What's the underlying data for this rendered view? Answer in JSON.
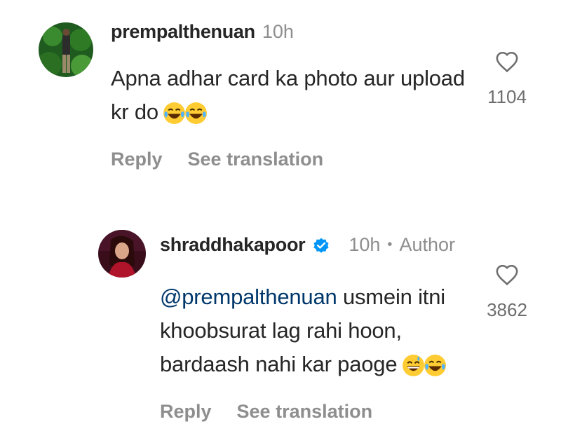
{
  "comments": [
    {
      "username": "prempalthenuan",
      "time": "10h",
      "text": "Apna adhar card ka photo aur upload kr do",
      "line1": "Apna adhar card ka photo aur upload",
      "line2": "kr do",
      "emojis": [
        "face-with-tears-of-joy",
        "face-with-tears-of-joy"
      ],
      "like_count": "1104",
      "actions": {
        "reply": "Reply",
        "translate": "See translation"
      }
    },
    {
      "username": "shraddhakapoor",
      "verified": true,
      "time": "10h",
      "separator": "•",
      "author_label": "Author",
      "mention": "@prempalthenuan",
      "line1_rest": " usmein itni",
      "line2": "khoobsurat lag rahi hoon,",
      "line3": "bardaash nahi kar paoge",
      "emojis": [
        "grinning-face-with-sweat",
        "face-with-tears-of-joy"
      ],
      "like_count": "3862",
      "actions": {
        "reply": "Reply",
        "translate": "See translation"
      }
    }
  ],
  "icons": {
    "like": "heart-outline-icon",
    "verified": "verified-badge-icon"
  },
  "colors": {
    "text": "#262626",
    "muted": "#8e8e8e",
    "mention": "#00376b",
    "verified": "#0095f6"
  }
}
